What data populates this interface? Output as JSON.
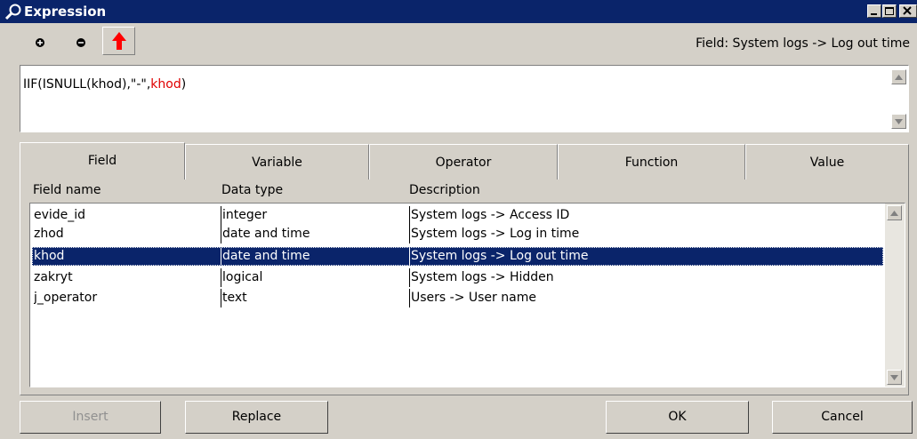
{
  "window": {
    "title": "Expression"
  },
  "toolbar": {
    "field_info": "Field: System logs -> Log out time"
  },
  "expression": {
    "part1": "IIF(ISNULL(khod),\"-\",",
    "part2": "khod",
    "part3": ")"
  },
  "tabs": [
    {
      "label": "Field"
    },
    {
      "label": "Variable"
    },
    {
      "label": "Operator"
    },
    {
      "label": "Function"
    },
    {
      "label": "Value"
    }
  ],
  "list": {
    "headers": [
      "Field name",
      "Data type",
      "Description"
    ],
    "rows": [
      {
        "name": "evide_id",
        "type": "integer",
        "desc": "System logs -> Access ID"
      },
      {
        "name": "zhod",
        "type": "date and time",
        "desc": "System logs -> Log in time"
      },
      {
        "name": "khod",
        "type": "date and time",
        "desc": "System logs -> Log out time"
      },
      {
        "name": "zakryt",
        "type": "logical",
        "desc": "System logs -> Hidden"
      },
      {
        "name": "j_operator",
        "type": "text",
        "desc": "Users -> User name"
      }
    ],
    "selected_index": 2
  },
  "buttons": {
    "insert": "Insert",
    "replace": "Replace",
    "ok": "OK",
    "cancel": "Cancel"
  },
  "colors": {
    "titlebar": "#0a246a",
    "selection": "#0a246a",
    "face": "#d4d0c8",
    "highlight_text": "#e00000"
  }
}
